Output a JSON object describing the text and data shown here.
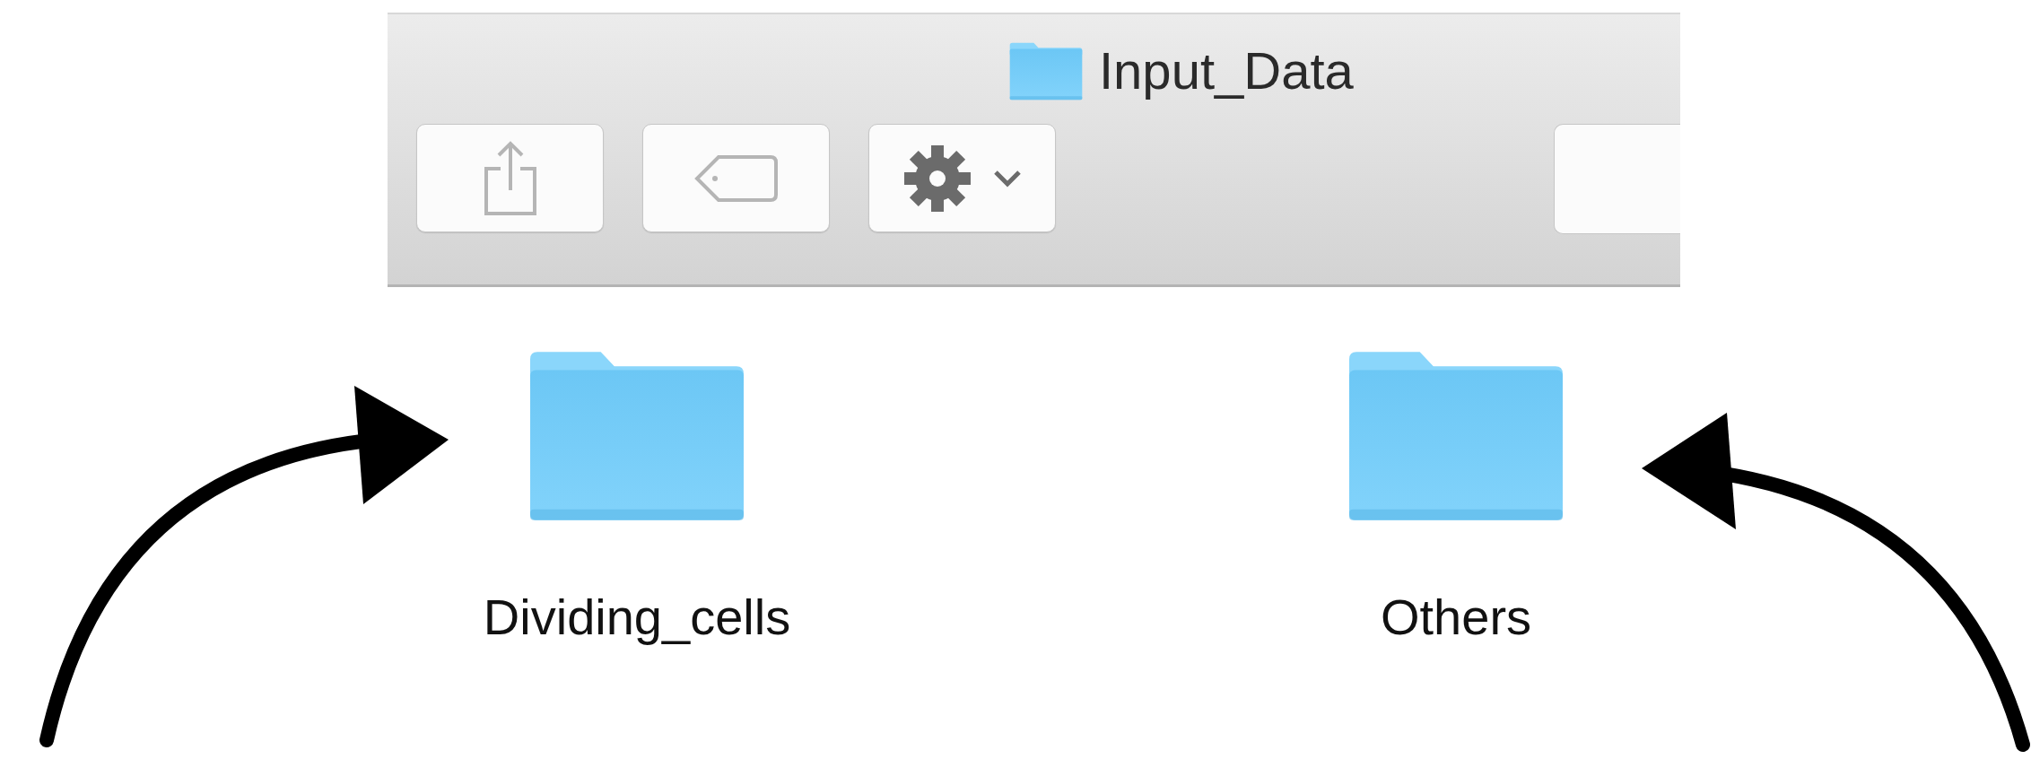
{
  "window": {
    "title": "Input_Data"
  },
  "toolbar": {
    "buttons": [
      {
        "kind": "share",
        "disabled": true
      },
      {
        "kind": "tag",
        "disabled": true
      },
      {
        "kind": "action",
        "disabled": false
      }
    ]
  },
  "items": [
    {
      "name": "Dividing_cells"
    },
    {
      "name": "Others"
    }
  ]
}
